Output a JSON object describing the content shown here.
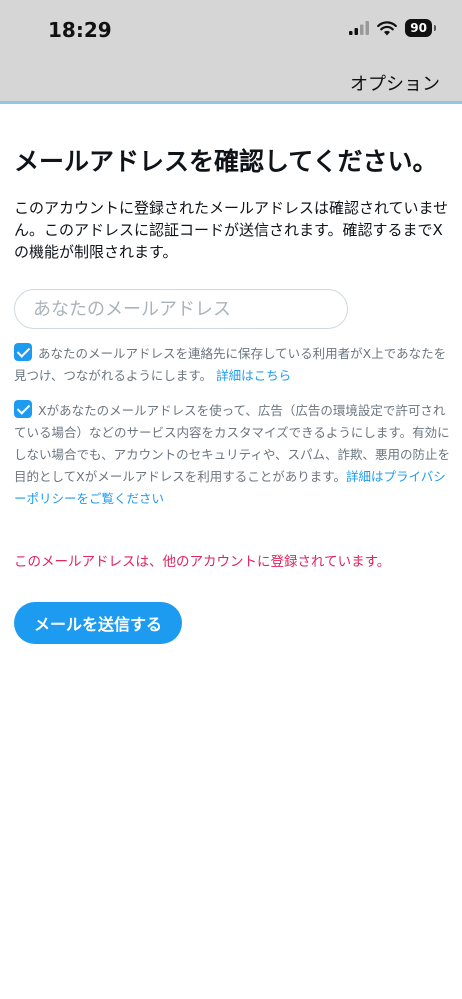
{
  "status_bar": {
    "time": "18:29",
    "signal_icon": "signal-bars-icon",
    "wifi_icon": "wifi-icon",
    "battery": "90"
  },
  "nav": {
    "options_label": "オプション"
  },
  "main": {
    "heading": "メールアドレスを確認してください。",
    "description": "このアカウントに登録されたメールアドレスは確認されていません。このアドレスに認証コードが送信されます。確認するまでXの機能が制限されます。",
    "email_placeholder": "あなたのメールアドレス",
    "checkbox1": {
      "checked": true,
      "text": "あなたのメールアドレスを連絡先に保存している利用者がX上であなたを見つけ、つながれるようにします。",
      "link": "詳細はこちら"
    },
    "checkbox2": {
      "checked": true,
      "text": "Xがあなたのメールアドレスを使って、広告（広告の環境設定で許可されている場合）などのサービス内容をカスタマイズできるようにします。有効にしない場合でも、アカウントのセキュリティや、スパム、詐欺、悪用の防止を目的としてXがメールアドレスを利用することがあります。",
      "link": "詳細はプライバシーポリシーをご覧ください"
    },
    "error": "このメールアドレスは、他のアカウントに登録されています。",
    "send_button": "メールを送信する"
  },
  "colors": {
    "accent": "#1d9bf0",
    "error": "#e0245e",
    "header_bg": "#d6d6d6"
  }
}
